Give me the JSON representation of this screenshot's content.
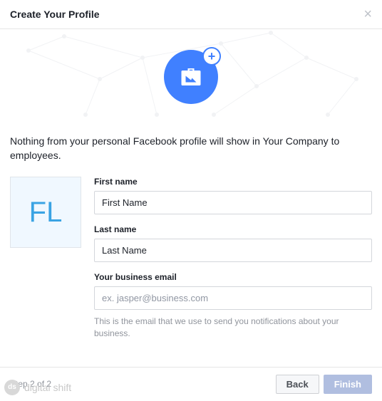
{
  "header": {
    "title": "Create Your Profile"
  },
  "intro": "Nothing from your personal Facebook profile will show in Your Company to employees.",
  "avatar": {
    "initials": "FL"
  },
  "form": {
    "first_name": {
      "label": "First name",
      "value": "First Name"
    },
    "last_name": {
      "label": "Last name",
      "value": "Last Name"
    },
    "email": {
      "label": "Your business email",
      "placeholder": "ex. jasper@business.com",
      "help": "This is the email that we use to send you notifications about your business."
    }
  },
  "footer": {
    "step": "Step 2 of 2",
    "back": "Back",
    "finish": "Finish"
  },
  "watermark": {
    "badge": "ds",
    "text": "digital shift"
  }
}
